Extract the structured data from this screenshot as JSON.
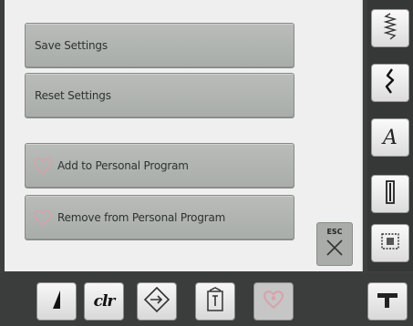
{
  "menu": {
    "save_settings": "Save Settings",
    "reset_settings": "Reset Settings",
    "add_personal": "Add to Personal Program",
    "remove_personal": "Remove from Personal Program",
    "esc_label": "ESC"
  },
  "bottom": {
    "clr_label": "clr"
  },
  "rail": {
    "a_label": "A"
  },
  "colors": {
    "button_face": "#b0b3b0",
    "heart_icon": "#d6a2ac",
    "content_bg": "#efefef"
  }
}
